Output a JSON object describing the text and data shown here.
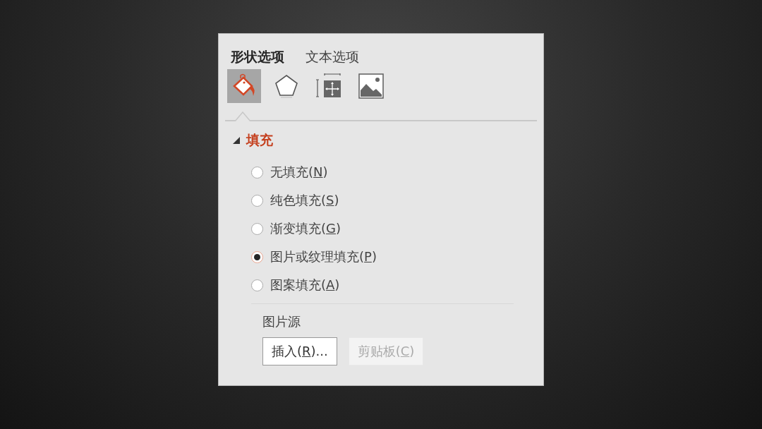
{
  "tabs": [
    {
      "label": "形状选项",
      "selected": true
    },
    {
      "label": "文本选项",
      "selected": false
    }
  ],
  "icon_tabs": [
    {
      "kind": "fill",
      "selected": true
    },
    {
      "kind": "effects",
      "selected": false
    },
    {
      "kind": "size",
      "selected": false
    },
    {
      "kind": "picture",
      "selected": false
    }
  ],
  "section": {
    "title": "填充",
    "expanded": true
  },
  "fill_options": [
    {
      "before": "无填充(",
      "key": "N",
      "after": ")",
      "selected": false
    },
    {
      "before": "纯色填充(",
      "key": "S",
      "after": ")",
      "selected": false
    },
    {
      "before": "渐变填充(",
      "key": "G",
      "after": ")",
      "selected": false
    },
    {
      "before": "图片或纹理填充(",
      "key": "P",
      "after": ")",
      "selected": true
    },
    {
      "before": "图案填充(",
      "key": "A",
      "after": ")",
      "selected": false
    }
  ],
  "picture_source": {
    "label": "图片源",
    "buttons": [
      {
        "before": "插入(",
        "key": "R",
        "after": ")...",
        "disabled": false
      },
      {
        "before": "剪贴板(",
        "key": "C",
        "after": ")",
        "disabled": true
      }
    ]
  }
}
